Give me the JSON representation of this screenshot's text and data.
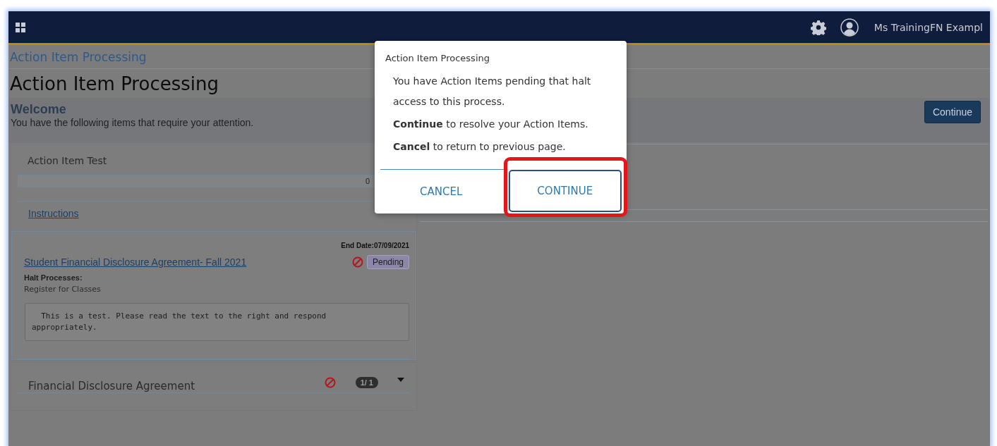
{
  "top_bar": {
    "user_name": "Ms TrainingFN Exampl"
  },
  "breadcrumb": "Action Item Processing",
  "page_title": "Action Item Processing",
  "welcome": {
    "heading": "Welcome",
    "message": "You have the following items that require your attention.",
    "continue_button": "Continue"
  },
  "groups": [
    {
      "title": "Action Item Test",
      "progress": {
        "level": 0,
        "reading": "0"
      },
      "instructions_link": "Instructions",
      "items": [
        {
          "end_date": "End Date:07/09/2021",
          "title": "Student Financial Disclosure Agreement- Fall 2021",
          "halted": true,
          "status": "Pending",
          "halt_label": "Halt Processes:",
          "halt_process": "Register for Classes",
          "note": "  This is a test. Please read the text to the right and respond\nappropriately."
        }
      ]
    },
    {
      "title": "Financial Disclosure Agreement",
      "halted": true,
      "count": "1/ 1"
    }
  ],
  "dialog": {
    "title": "Action Item Processing",
    "message": "You have Action Items pending that halt access to this process.",
    "lines": [
      "**Continue** to resolve your Action Items.",
      "**Cancel** to return to previous page."
    ],
    "buttons": [
      {
        "label": "CANCEL",
        "highlighted": false
      },
      {
        "label": "CONTINUE",
        "highlighted": true
      }
    ]
  }
}
